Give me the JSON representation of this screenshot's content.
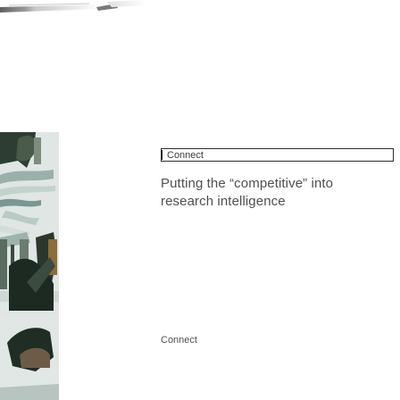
{
  "search": {
    "value": "Connect",
    "placeholder": ""
  },
  "article": {
    "headline": "Putting the “competitive” into research intelligence"
  },
  "footer_link": {
    "label": "Connect"
  },
  "colors": {
    "text": "#505050",
    "field_border": "#2c2c2c",
    "background": "#ffffff"
  },
  "icons": {
    "thumbnail": "collage-image",
    "header_art": "gradient-banner"
  }
}
